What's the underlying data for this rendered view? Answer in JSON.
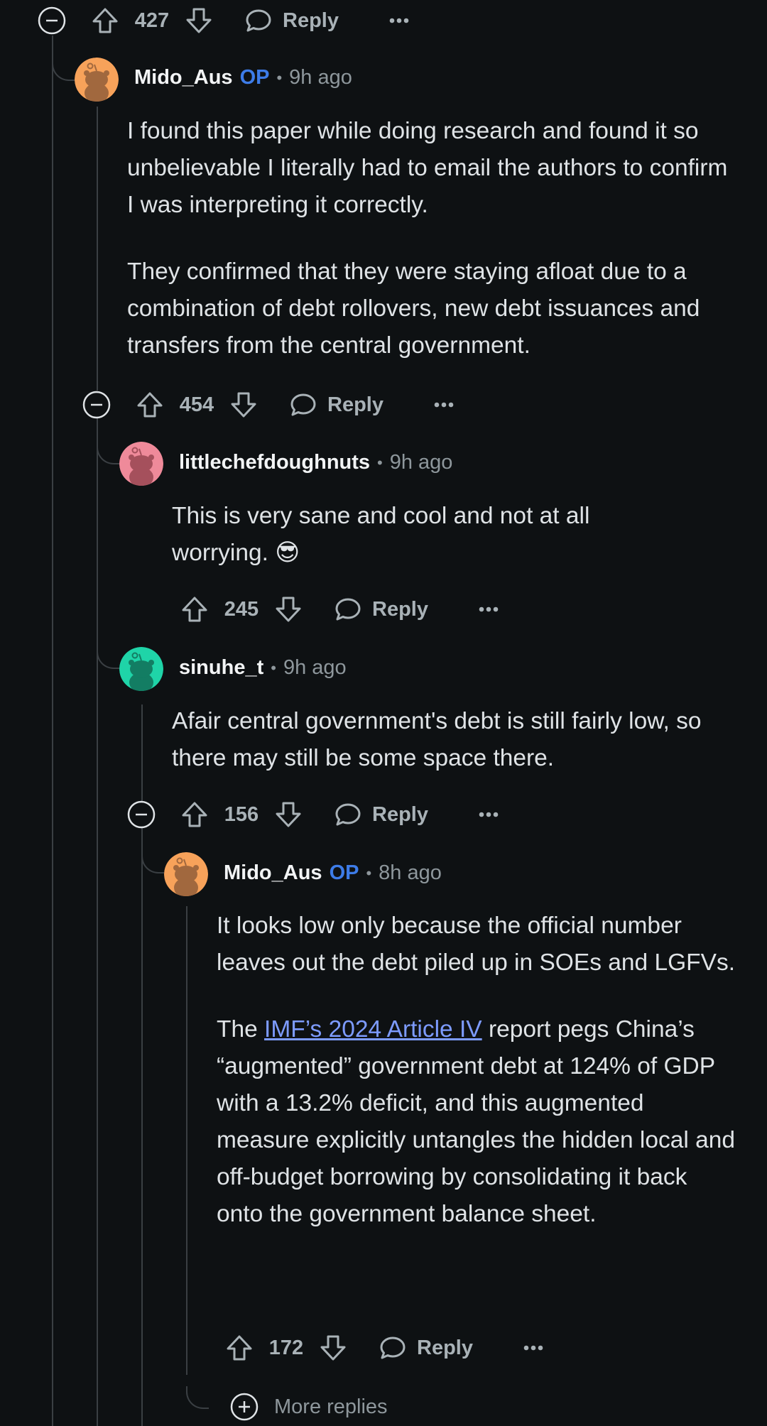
{
  "top_actions": {
    "votes": "427",
    "reply": "Reply"
  },
  "comments": [
    {
      "user": "Mido_Aus",
      "op": "OP",
      "separator": "•",
      "time": "9h ago",
      "paragraphs": [
        "I found this paper while doing research and found it so unbelievable I literally had to email the authors to confirm I was interpreting it correctly.",
        "They confirmed that they were staying afloat due to a combination of debt rollovers, new debt issuances and transfers from the central government."
      ],
      "votes": "454",
      "reply": "Reply"
    },
    {
      "user": "littlechefdoughnuts",
      "separator": "•",
      "time": "9h ago",
      "paragraphs": [
        "This is very sane and cool and not at all worrying. 😎"
      ],
      "votes": "245",
      "reply": "Reply"
    },
    {
      "user": "sinuhe_t",
      "separator": "•",
      "time": "9h ago",
      "paragraphs": [
        "Afair central government's debt is still fairly low, so there may still be some space there."
      ],
      "votes": "156",
      "reply": "Reply"
    },
    {
      "user": "Mido_Aus",
      "op": "OP",
      "separator": "•",
      "time": "8h ago",
      "paragraph1": "It looks low only because the official number leaves out the debt piled up in SOEs and LGFVs.",
      "p2_prefix": "The ",
      "p2_link": "IMF’s 2024 Article IV",
      "p2_suffix": " report pegs China’s “augmented” government debt at 124% of GDP with a 13.2% deficit, and this augmented measure explicitly untangles the hidden local and off-budget borrowing by consolidating it back onto the government balance sheet.",
      "votes": "172",
      "reply": "Reply"
    }
  ],
  "more_replies": "More replies",
  "colors": {
    "background": "#0e1113",
    "op_badge": "#3d7ce8",
    "link": "#7d9bff",
    "avatar_orange": "#f7a25a",
    "avatar_pink": "#ef8a9a",
    "avatar_teal": "#1fd4a8"
  },
  "icons": [
    "collapse-icon",
    "upvote-icon",
    "downvote-icon",
    "reply-icon",
    "more-icon",
    "expand-icon",
    "avatar-snoo-icon"
  ]
}
